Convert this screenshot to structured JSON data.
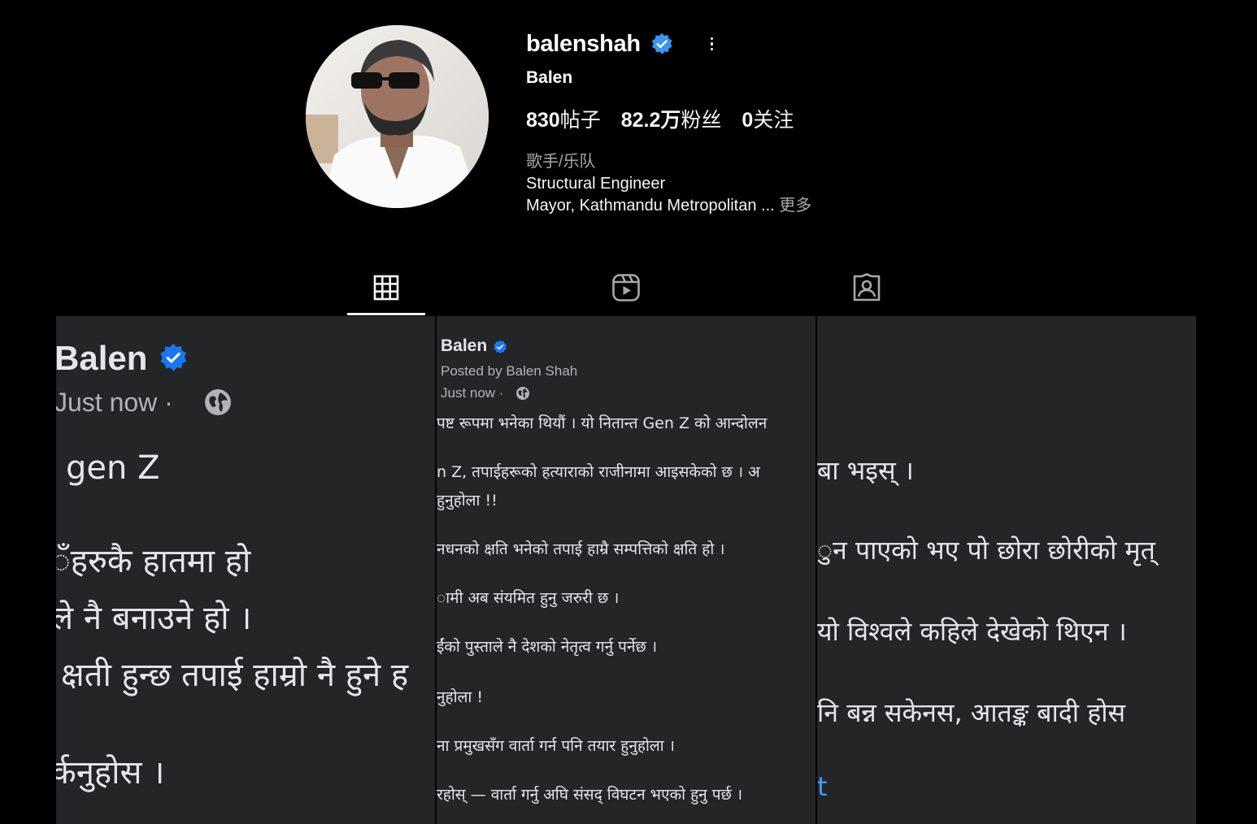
{
  "profile": {
    "username": "balenshah",
    "full_name": "Balen",
    "verified": true,
    "stats": [
      {
        "value": "830",
        "label": "帖子"
      },
      {
        "value": "82.2万",
        "label": "粉丝"
      },
      {
        "value": "0",
        "label": "关注"
      }
    ],
    "category": "歌手/乐队",
    "bio_line1": "Structural Engineer",
    "bio_line2": "Mayor, Kathmandu Metropolitan",
    "bio_ellipsis": " ... ",
    "bio_more": "更多"
  },
  "tabs": [
    {
      "icon": "grid-icon",
      "active": true
    },
    {
      "icon": "reels-icon",
      "active": false
    },
    {
      "icon": "tagged-icon",
      "active": false
    }
  ],
  "colors": {
    "background": "#000000",
    "post_bg": "#242526",
    "verified_blue": "#3897f0",
    "post_badge_blue": "#1877f2",
    "link_blue": "#4599ff",
    "muted": "#a8a8a8"
  },
  "posts": [
    {
      "name": "Balen",
      "time": "Just now ·",
      "lines": [
        "gen Z",
        "ँहरुकै हातमा हो",
        "ले नै बनाउने हो ।",
        "क्षती हुन्छ तपाई हाम्रो नै हुने ह",
        "र्कनुहोस ।"
      ]
    },
    {
      "name": "Balen",
      "posted_by": "Posted by Balen Shah",
      "time": "Just now ·",
      "lines": [
        "पष्ट रूपमा भनेका थियौं । यो नितान्त Gen Z को आन्दोलन",
        "n Z, तपाईहरूको हत्याराको राजीनामा आइसकेको छ । अ",
        "हुनुहोला !!",
        "नधनको क्षति भनेको तपाई हाम्रै सम्पत्तिको क्षति हो ।",
        "ामी अब संयमित हुनु जरुरी छ ।",
        "ईंको पुस्ताले नै देशको नेतृत्व गर्नु पर्नेछ ।",
        "नुहोला !",
        "ना प्रमुखसँग वार्ता गर्न पनि  तयार हुनुहोला ।",
        "रहोस् — वार्ता गर्नु अघि संसद् विघटन भएको हुनु पर्छ ।"
      ]
    },
    {
      "lines": [
        "बा भइस् ।",
        "ुन पाएको  भए पो छोरा छोरीको मृत्",
        "यो विश्वले कहिले देखेको थिएन ।",
        "नि बन्न सकेनस, आतङ्क बादी होस",
        "t"
      ]
    }
  ]
}
